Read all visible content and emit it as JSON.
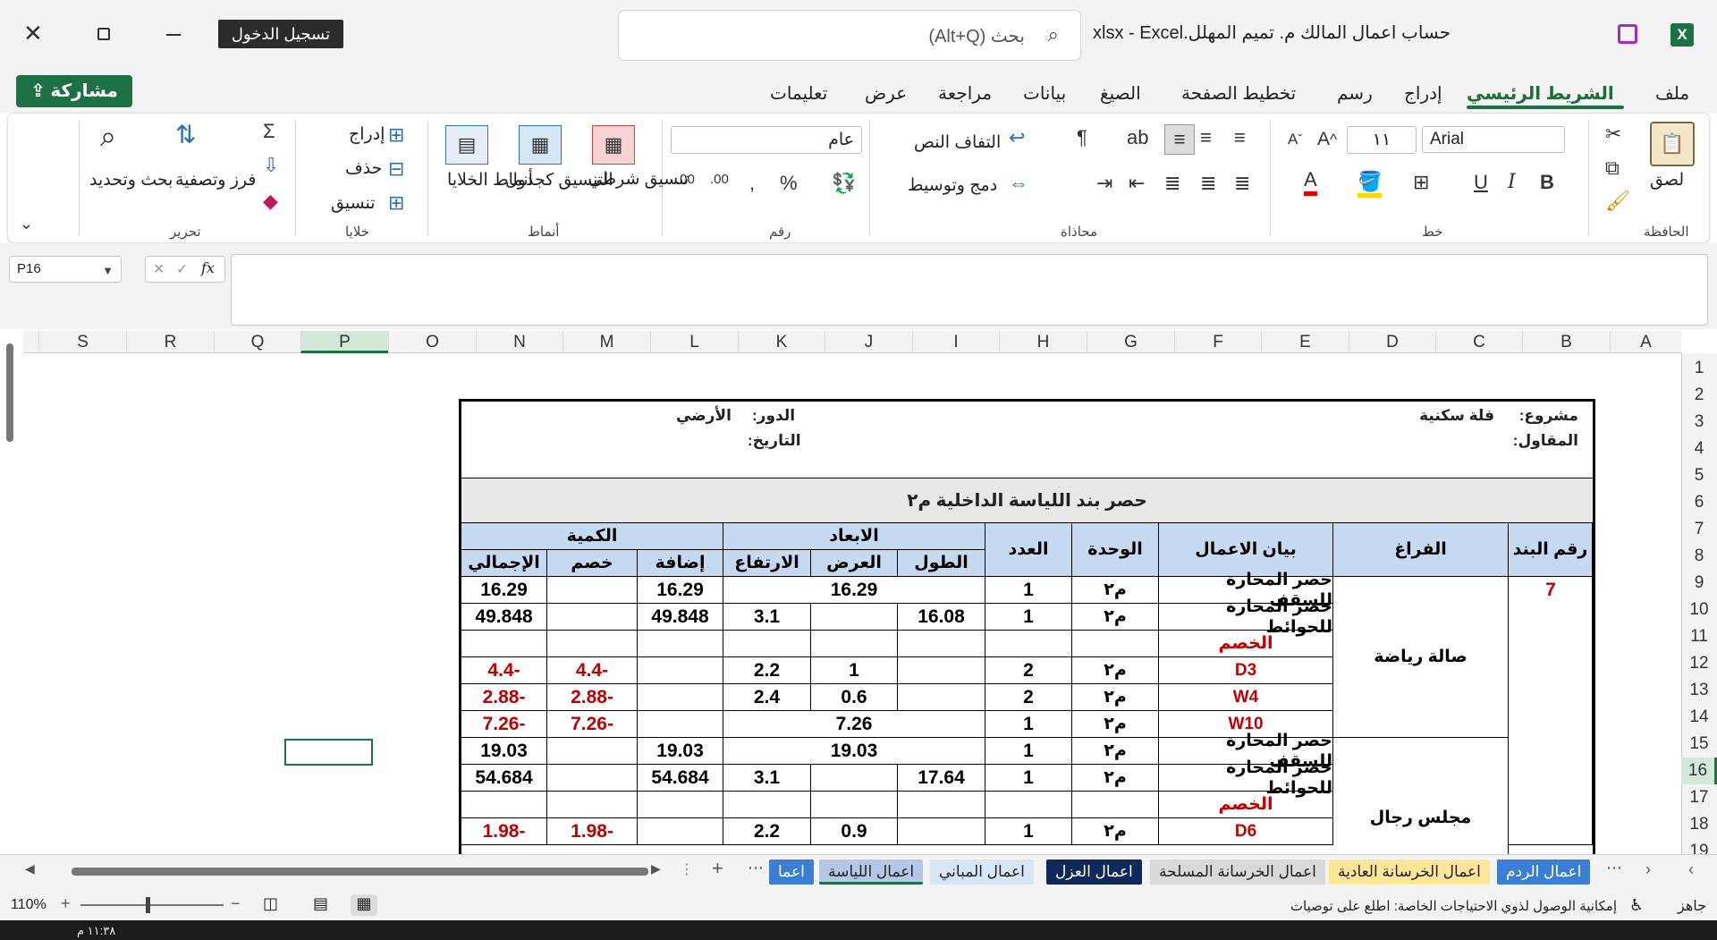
{
  "window": {
    "title": "حساب اعمال المالك م. تميم المهلل.xlsx  -  Excel",
    "signin": "تسجيل الدخول",
    "search_placeholder": "بحث (Alt+Q)"
  },
  "tabs": [
    "ملف",
    "الشريط الرئيسي",
    "إدراج",
    "رسم",
    "تخطيط الصفحة",
    "الصيغ",
    "بيانات",
    "مراجعة",
    "عرض",
    "تعليمات"
  ],
  "share": "مشاركة",
  "ribbon": {
    "clipboard": {
      "paste": "لصق",
      "group": "الحافظة"
    },
    "font": {
      "name": "Arial",
      "size": "١١",
      "group": "خط",
      "bold": "B",
      "italic": "I",
      "underline": "U"
    },
    "alignment": {
      "wrap": "التفاف النص",
      "merge": "دمج وتوسيط",
      "group": "محاذاة"
    },
    "number": {
      "format": "عام",
      "group": "رقم"
    },
    "styles": {
      "conditional": "تنسيق شرطي",
      "table": "التنسيق كجدول",
      "cell": "أنماط الخلايا",
      "group": "أنماط"
    },
    "cells": {
      "insert": "إدراج",
      "delete": "حذف",
      "format": "تنسيق",
      "group": "خلايا"
    },
    "editing": {
      "sort": "فرز وتصفية",
      "find": "بحث وتحديد",
      "group": "تحرير"
    }
  },
  "namebox": "P16",
  "columns": [
    "A",
    "B",
    "C",
    "D",
    "E",
    "F",
    "G",
    "H",
    "I",
    "J",
    "K",
    "L",
    "M",
    "N",
    "O",
    "P",
    "Q",
    "R",
    "S"
  ],
  "rows": [
    "1",
    "2",
    "3",
    "4",
    "5",
    "6",
    "7",
    "8",
    "9",
    "10",
    "11",
    "12",
    "13",
    "14",
    "15",
    "16",
    "17",
    "18",
    "19"
  ],
  "sheet": {
    "project_label": "مشروع:",
    "project": "فلة سكنية",
    "contractor_label": "المقاول:",
    "floor_label": "الدور:",
    "floor": "الأرضي",
    "date_label": "التاريخ:",
    "title": "حصر بند اللياسة الداخلية م٢",
    "headers": {
      "item": "رقم البند",
      "space": "الفراغ",
      "desc": "بيان الاعمال",
      "unit": "الوحدة",
      "count": "العدد",
      "dims": "الابعاد",
      "length": "الطول",
      "width": "العرض",
      "height": "الارتفاع",
      "qty": "الكمية",
      "add": "إضافة",
      "deduct": "خصم",
      "total": "الإجمالي"
    },
    "item_no": "7",
    "space1": "صالة رياضة",
    "space2": "مجلس رجال",
    "r10": {
      "desc": "حصر المحارة للسقف",
      "unit": "م٢",
      "count": "1",
      "area": "16.29",
      "add": "16.29",
      "total": "16.29"
    },
    "r11": {
      "desc": "حصر المحارة للحوائط",
      "unit": "م٢",
      "count": "1",
      "length": "16.08",
      "height": "3.1",
      "add": "49.848",
      "total": "49.848"
    },
    "r12": {
      "desc": "الخصم"
    },
    "r13": {
      "desc": "D3",
      "unit": "م٢",
      "count": "2",
      "width": "1",
      "height": "2.2",
      "deduct": "-4.4",
      "total": "-4.4"
    },
    "r14": {
      "desc": "W4",
      "unit": "م٢",
      "count": "2",
      "width": "0.6",
      "height": "2.4",
      "deduct": "-2.88",
      "total": "-2.88"
    },
    "r15": {
      "desc": "W10",
      "unit": "م٢",
      "count": "1",
      "area": "7.26",
      "deduct": "-7.26",
      "total": "-7.26"
    },
    "r16": {
      "desc": "حصر المحارة للسقف",
      "unit": "م٢",
      "count": "1",
      "area": "19.03",
      "add": "19.03",
      "total": "19.03"
    },
    "r17": {
      "desc": "حصر المحارة للحوائط",
      "unit": "م٢",
      "count": "1",
      "length": "17.64",
      "height": "3.1",
      "add": "54.684",
      "total": "54.684"
    },
    "r18": {
      "desc": "الخصم"
    },
    "r19": {
      "desc": "D6",
      "unit": "م٢",
      "count": "1",
      "width": "0.9",
      "height": "2.2",
      "deduct": "-1.98",
      "total": "-1.98"
    }
  },
  "sheet_tabs": [
    "اعمال الردم",
    "اعمال الخرسانة العادية",
    "اعمال الخرسانة المسلحة",
    "اعمال العزل",
    "اعمال المباني",
    "اعمال اللياسة",
    "اعما"
  ],
  "status": {
    "ready": "جاهز",
    "accessibility": "إمكانية الوصول لذوي الاحتياجات الخاصة: اطلع على توصيات",
    "zoom": "110%",
    "time": "١١:٣٨ م"
  },
  "colors": {
    "accent": "#1e7145",
    "header_fill": "#c5d9f1",
    "red": "#c00000"
  }
}
